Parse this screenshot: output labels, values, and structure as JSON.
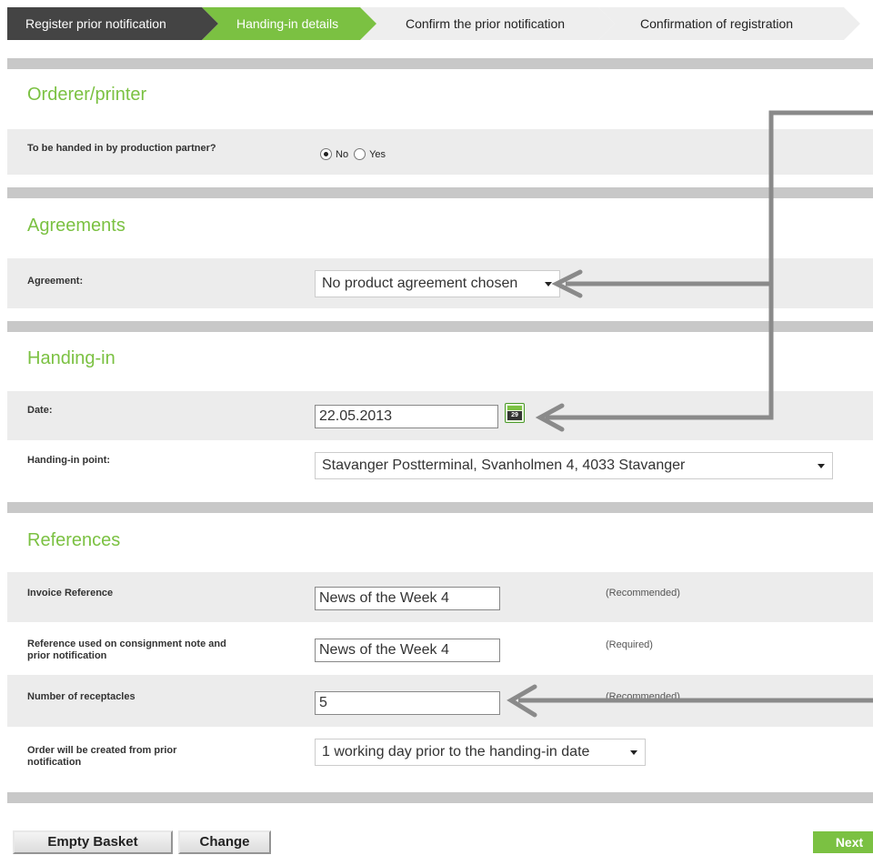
{
  "steps": [
    "Register prior notification",
    "Handing-in details",
    "Confirm the prior notification",
    "Confirmation of registration"
  ],
  "orderer": {
    "title": "Orderer/printer",
    "production_partner_label": "To be handed in by production partner?",
    "option_no": "No",
    "option_yes": "Yes",
    "selected": "No"
  },
  "agreements": {
    "title": "Agreements",
    "agreement_label": "Agreement:",
    "agreement_value": "No product agreement chosen"
  },
  "handing_in": {
    "title": "Handing-in",
    "date_label": "Date:",
    "date_value": "22.05.2013",
    "calendar_day": "29",
    "point_label": "Handing-in point:",
    "point_value": "Stavanger Postterminal, Svanholmen 4, 4033 Stavanger"
  },
  "references": {
    "title": "References",
    "invoice_label": "Invoice Reference",
    "invoice_value": "News of the Week 4",
    "invoice_hint": "(Recommended)",
    "consignment_label_1": "Reference used on consignment note and",
    "consignment_label_2": "prior notification",
    "consignment_value": "News of the Week 4",
    "consignment_hint": "(Required)",
    "receptacles_label": "Number of receptacles",
    "receptacles_value": "5",
    "receptacles_hint": "(Recommended)",
    "order_label_1": "Order will be created from prior",
    "order_label_2": "notification",
    "order_value": "1 working day prior to the handing-in date"
  },
  "buttons": {
    "empty_basket": "Empty Basket",
    "change": "Change",
    "next": "Next"
  },
  "colors": {
    "accent": "#7bc142",
    "dark_step": "#444444",
    "annotation_arrow": "#8a8a8a"
  }
}
